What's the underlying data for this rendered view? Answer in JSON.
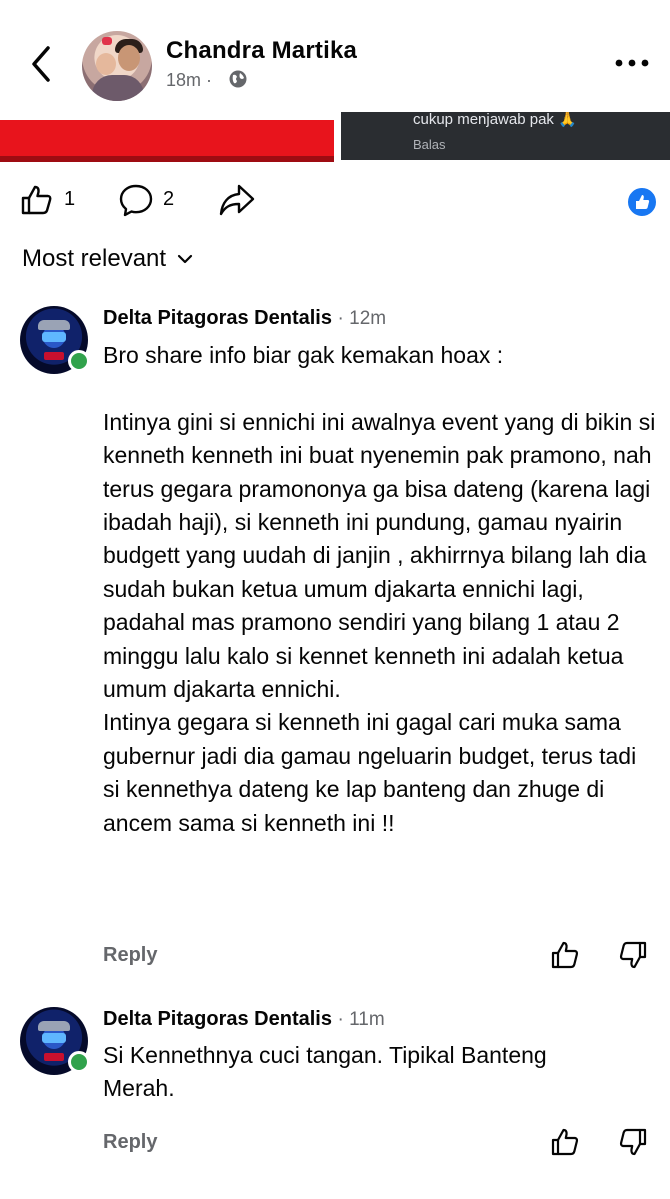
{
  "header": {
    "author_name": "Chandra Martika",
    "time": "18m ·",
    "icons": {
      "back": "chevron-left-icon",
      "privacy": "globe-icon",
      "more": "more-horizontal-icon"
    }
  },
  "media_strip": {
    "right_text": "cukup menjawab pak 🙏",
    "right_sub": "Balas",
    "colors": {
      "left": "#e8141c",
      "right": "#2a2d31"
    }
  },
  "actions": {
    "like_count": "1",
    "comment_count": "2",
    "icons": [
      "like-icon",
      "comment-icon",
      "share-icon",
      "like-reaction-icon"
    ]
  },
  "sort": {
    "label": "Most relevant"
  },
  "comments": [
    {
      "author": "Delta Pitagoras Dentalis",
      "time": "· 12m",
      "paragraphs": [
        "Bro share info biar gak kemakan hoax :",
        "Intinya gini si ennichi ini awalnya event yang di bikin si kenneth kenneth ini buat nyenemin pak pramono, nah terus gegara pramononya ga bisa dateng (karena lagi ibadah haji), si kenneth ini pundung, gamau nyairin budgett yang uudah di janjin , akhirrnya bilang lah dia sudah bukan ketua umum djakarta ennichi lagi, padahal mas pramono sendiri yang bilang 1 atau 2 minggu lalu kalo si kennet kenneth ini adalah ketua umum djakarta ennichi.",
        "Intinya gegara si kenneth ini gagal cari muka sama gubernur jadi dia gamau ngeluarin budget, terus tadi si kennethya dateng ke lap banteng dan zhuge di ancem sama si kenneth ini !!"
      ],
      "reply_label": "Reply"
    },
    {
      "author": "Delta Pitagoras Dentalis",
      "time": "· 11m",
      "paragraphs": [
        "Si Kennethnya cuci tangan. Tipikal Banteng Merah."
      ],
      "reply_label": "Reply"
    }
  ],
  "colors": {
    "accent": "#1877f2",
    "online": "#31a24c",
    "secondary_text": "#65676b"
  }
}
